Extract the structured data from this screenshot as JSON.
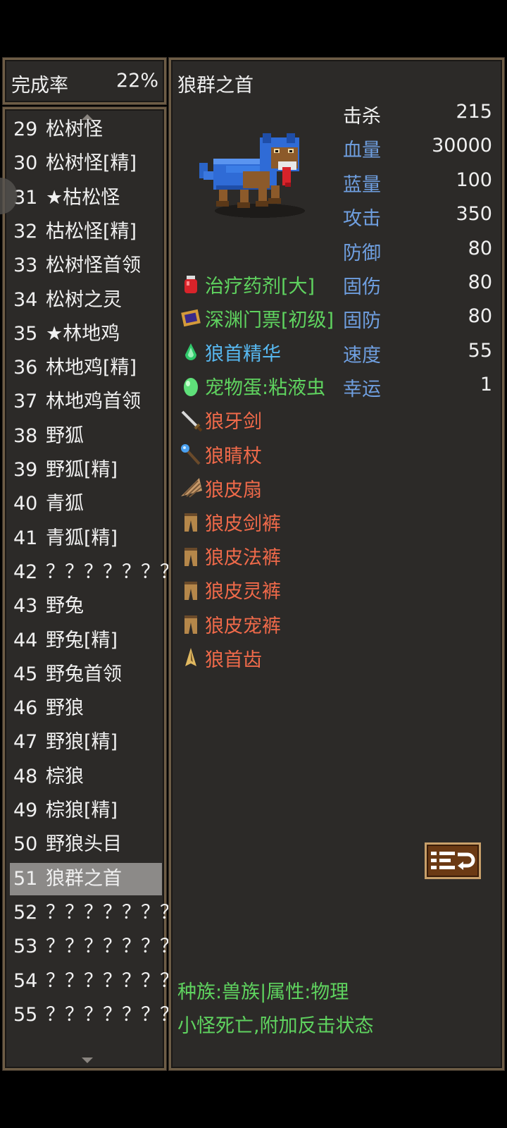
{
  "completion": {
    "label": "完成率",
    "value": "22%"
  },
  "list": {
    "items": [
      {
        "num": "29",
        "name": "松树怪"
      },
      {
        "num": "30",
        "name": "松树怪[精]"
      },
      {
        "num": "31",
        "name": "★枯松怪"
      },
      {
        "num": "32",
        "name": "枯松怪[精]"
      },
      {
        "num": "33",
        "name": "松树怪首领"
      },
      {
        "num": "34",
        "name": "松树之灵"
      },
      {
        "num": "35",
        "name": "★林地鸡"
      },
      {
        "num": "36",
        "name": "林地鸡[精]"
      },
      {
        "num": "37",
        "name": "林地鸡首领"
      },
      {
        "num": "38",
        "name": "野狐"
      },
      {
        "num": "39",
        "name": "野狐[精]"
      },
      {
        "num": "40",
        "name": "青狐"
      },
      {
        "num": "41",
        "name": "青狐[精]"
      },
      {
        "num": "42",
        "name": "？？？？？？？"
      },
      {
        "num": "43",
        "name": "野兔"
      },
      {
        "num": "44",
        "name": "野兔[精]"
      },
      {
        "num": "45",
        "name": "野兔首领"
      },
      {
        "num": "46",
        "name": "野狼"
      },
      {
        "num": "47",
        "name": "野狼[精]"
      },
      {
        "num": "48",
        "name": "棕狼"
      },
      {
        "num": "49",
        "name": "棕狼[精]"
      },
      {
        "num": "50",
        "name": "野狼头目"
      },
      {
        "num": "51",
        "name": "狼群之首",
        "selected": true
      },
      {
        "num": "52",
        "name": "？？？？？？？"
      },
      {
        "num": "53",
        "name": "？？？？？？？"
      },
      {
        "num": "54",
        "name": "？？？？？？？"
      },
      {
        "num": "55",
        "name": "？？？？？？？"
      }
    ]
  },
  "monster": {
    "name": "狼群之首",
    "stats": [
      {
        "label": "击杀",
        "value": "215",
        "color": "white"
      },
      {
        "label": "血量",
        "value": "30000",
        "color": "blue"
      },
      {
        "label": "蓝量",
        "value": "100",
        "color": "blue"
      },
      {
        "label": "攻击",
        "value": "350",
        "color": "blue"
      },
      {
        "label": "防御",
        "value": "80",
        "color": "blue"
      },
      {
        "label": "固伤",
        "value": "80",
        "color": "blue"
      },
      {
        "label": "固防",
        "value": "80",
        "color": "blue"
      },
      {
        "label": "速度",
        "value": "55",
        "color": "blue"
      },
      {
        "label": "幸运",
        "value": "1",
        "color": "blue"
      }
    ],
    "drops": [
      {
        "name": "治疗药剂[大]",
        "color": "green",
        "icon": "potion-icon"
      },
      {
        "name": "深渊门票[初级]",
        "color": "green",
        "icon": "ticket-icon"
      },
      {
        "name": "狼首精华",
        "color": "cyan",
        "icon": "essence-icon"
      },
      {
        "name": "宠物蛋:粘液虫",
        "color": "green",
        "icon": "egg-icon"
      },
      {
        "name": "狼牙剑",
        "color": "orange",
        "icon": "sword-icon"
      },
      {
        "name": "狼睛杖",
        "color": "orange",
        "icon": "staff-icon"
      },
      {
        "name": "狼皮扇",
        "color": "orange",
        "icon": "fan-icon"
      },
      {
        "name": "狼皮剑裤",
        "color": "orange",
        "icon": "pants-icon"
      },
      {
        "name": "狼皮法裤",
        "color": "orange",
        "icon": "pants-icon"
      },
      {
        "name": "狼皮灵裤",
        "color": "orange",
        "icon": "pants-icon"
      },
      {
        "name": "狼皮宠裤",
        "color": "orange",
        "icon": "pants-icon"
      },
      {
        "name": "狼首齿",
        "color": "orange",
        "icon": "tooth-icon"
      }
    ],
    "race_line": "种族:兽族|属性:物理",
    "ability_line": "小怪死亡,附加反击状态"
  },
  "colors": {
    "panel_bg": "#2c2a28",
    "border": "#6e5d46",
    "stat_blue": "#6f9fe0",
    "drop_green": "#5fd35f",
    "drop_cyan": "#57b8f0",
    "drop_orange": "#f06a4a",
    "selected_row": "#8c8a88"
  }
}
